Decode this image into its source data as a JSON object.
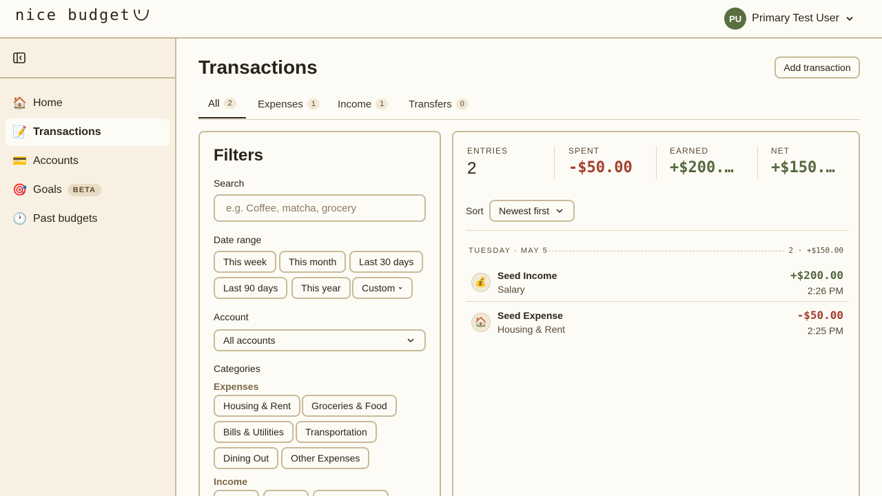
{
  "header": {
    "logo_text": "nice budget",
    "user_initials": "PU",
    "user_name": "Primary Test User"
  },
  "sidebar": {
    "items": [
      {
        "icon": "🏠",
        "label": "Home"
      },
      {
        "icon": "📝",
        "label": "Transactions"
      },
      {
        "icon": "💳",
        "label": "Accounts"
      },
      {
        "icon": "🎯",
        "label": "Goals",
        "badge": "BETA"
      },
      {
        "icon": "🕐",
        "label": "Past budgets"
      }
    ]
  },
  "main": {
    "title": "Transactions",
    "add_button": "Add transaction",
    "tabs": [
      {
        "label": "All",
        "count": "2"
      },
      {
        "label": "Expenses",
        "count": "1"
      },
      {
        "label": "Income",
        "count": "1"
      },
      {
        "label": "Transfers",
        "count": "0"
      }
    ]
  },
  "filters": {
    "title": "Filters",
    "search_label": "Search",
    "search_placeholder": "e.g. Coffee, matcha, grocery",
    "date_range_label": "Date range",
    "date_ranges": [
      "This week",
      "This month",
      "Last 30 days",
      "Last 90 days",
      "This year",
      "Custom"
    ],
    "account_label": "Account",
    "account_value": "All accounts",
    "categories_label": "Categories",
    "expenses_label": "Expenses",
    "expense_categories": [
      "Housing & Rent",
      "Groceries & Food",
      "Bills & Utilities",
      "Transportation",
      "Dining Out",
      "Other Expenses"
    ],
    "income_label": "Income"
  },
  "summary": {
    "entries_label": "ENTRIES",
    "entries_value": "2",
    "spent_label": "SPENT",
    "spent_value": "-$50.00",
    "earned_label": "EARNED",
    "earned_value": "+$200.…",
    "net_label": "NET",
    "net_value": "+$150.…",
    "sort_label": "Sort",
    "sort_value": "Newest first"
  },
  "day_group": {
    "date_label": "TUESDAY · MAY 5",
    "summary": "2 · +$150.00",
    "transactions": [
      {
        "icon": "💰",
        "name": "Seed Income",
        "category": "Salary",
        "amount": "+$200.00",
        "time": "2:26 PM"
      },
      {
        "icon": "🏠",
        "name": "Seed Expense",
        "category": "Housing & Rent",
        "amount": "-$50.00",
        "time": "2:25 PM"
      }
    ]
  },
  "colors": {
    "accent_green": "#55683e",
    "negative_red": "#a3402e",
    "border": "#c9b99a",
    "sidebar_bg": "#f8f1e3"
  }
}
